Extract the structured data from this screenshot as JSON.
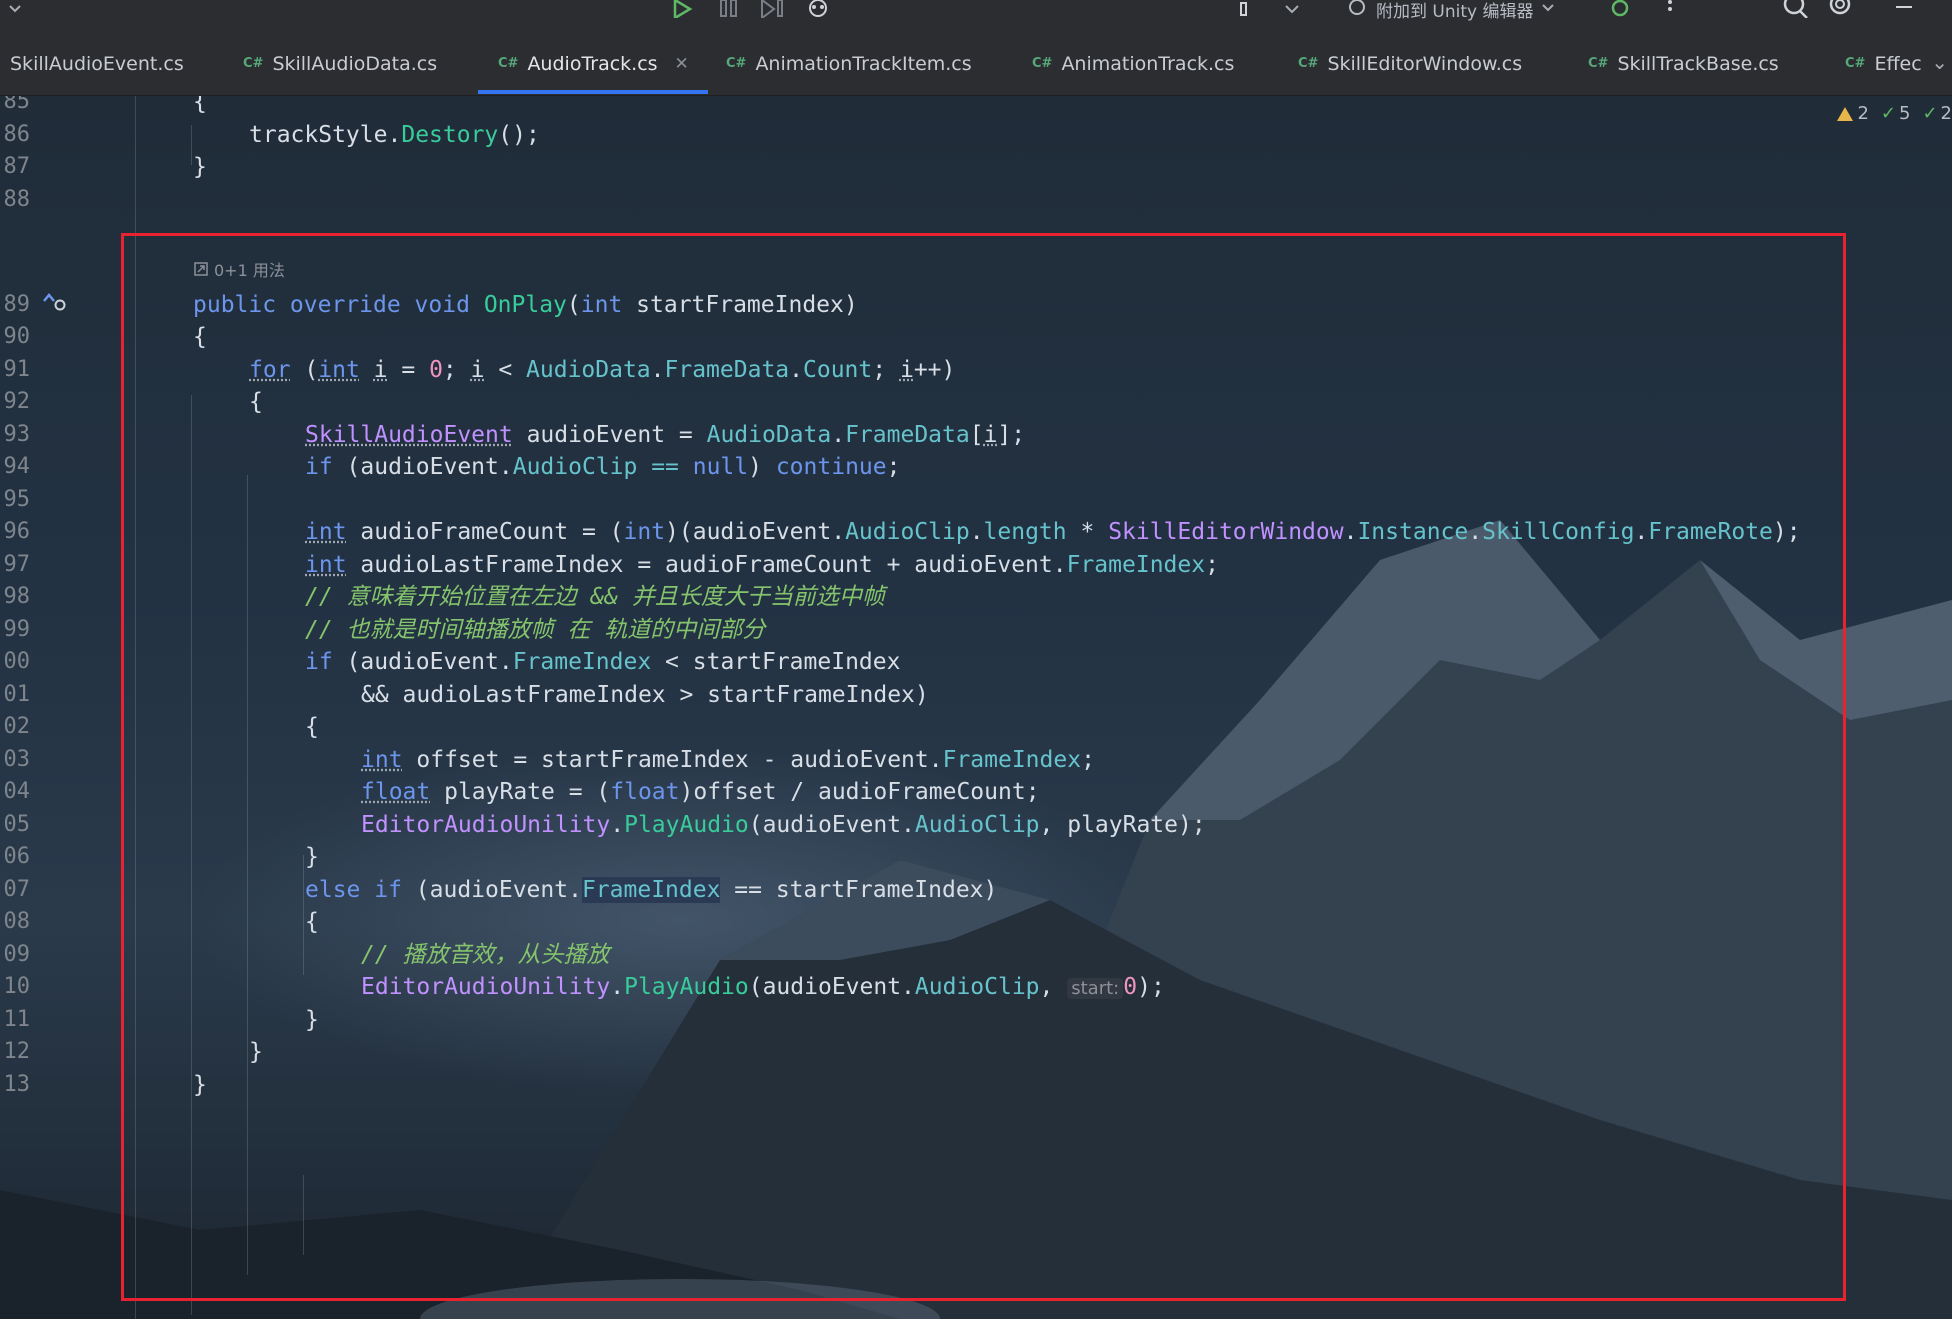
{
  "toolbar": {
    "attach_label": "附加到 Unity 编辑器",
    "run_icon": "run-icon",
    "pause_icon": "pause-icon",
    "step_icon": "step-icon"
  },
  "tabs": [
    {
      "label": "SkillAudioEvent.cs",
      "badge": ""
    },
    {
      "label": "SkillAudioData.cs",
      "badge": "C#"
    },
    {
      "label": "AudioTrack.cs",
      "badge": "C#",
      "active": true
    },
    {
      "label": "AnimationTrackItem.cs",
      "badge": "C#"
    },
    {
      "label": "AnimationTrack.cs",
      "badge": "C#"
    },
    {
      "label": "SkillEditorWindow.cs",
      "badge": "C#"
    },
    {
      "label": "SkillTrackBase.cs",
      "badge": "C#"
    },
    {
      "label": "Effec",
      "badge": "C#"
    }
  ],
  "inspections": {
    "warnings": "2",
    "ok": "5",
    "typos": "2"
  },
  "usage_hint": "0+1 用法",
  "param_hint": "start:",
  "line_numbers": [
    "85",
    "86",
    "87",
    "88",
    "89",
    "90",
    "91",
    "92",
    "93",
    "94",
    "95",
    "96",
    "97",
    "98",
    "99",
    "00",
    "01",
    "02",
    "03",
    "04",
    "05",
    "06",
    "07",
    "08",
    "09",
    "10",
    "11",
    "12",
    "13"
  ],
  "code": {
    "l85": "{",
    "l86_a": "trackStyle",
    "l86_b": ".",
    "l86_c": "Destory",
    "l86_d": "();",
    "l87": "}",
    "l89_kw": "public override void",
    "l89_fn": "OnPlay",
    "l89_p1": "(",
    "l89_ty": "int",
    "l89_rest": " startFrameIndex)",
    "l90": "{",
    "l91_for": "for",
    "l91_a": " (",
    "l91_int": "int",
    "l91_b": " ",
    "l91_i": "i",
    "l91_c": " = ",
    "l91_zero": "0",
    "l91_d": "; ",
    "l91_i2": "i",
    "l91_e": " < ",
    "l91_p1": "AudioData",
    "l91_dot1": ".",
    "l91_p2": "FrameData",
    "l91_dot2": ".",
    "l91_p3": "Count",
    "l91_f": "; ",
    "l91_i3": "i",
    "l91_g": "++)",
    "l92": "{",
    "l93_cls": "SkillAudioEvent",
    "l93_a": " audioEvent = ",
    "l93_p1": "AudioData",
    "l93_dot": ".",
    "l93_p2": "FrameData",
    "l93_b": "[",
    "l93_i": "i",
    "l93_c": "];",
    "l94_if": "if",
    "l94_a": " (audioEvent.",
    "l94_p": "AudioClip",
    "l94_op": " == ",
    "l94_null": "null",
    "l94_b": ") ",
    "l94_cont": "continue",
    "l94_c": ";",
    "l96_int": "int",
    "l96_a": " audioFrameCount = (",
    "l96_int2": "int",
    "l96_b": ")(audioEvent.",
    "l96_p1": "AudioClip",
    "l96_c": ".",
    "l96_p2": "length",
    "l96_d": " * ",
    "l96_cls": "SkillEditorWindow",
    "l96_e": ".",
    "l96_p3": "Instance",
    "l96_f": ".",
    "l96_p4": "SkillConfig",
    "l96_g": ".",
    "l96_p5": "FrameRote",
    "l96_h": ");",
    "l97_int": "int",
    "l97_a": " audioLastFrameIndex = audioFrameCount + audioEvent.",
    "l97_p": "FrameIndex",
    "l97_b": ";",
    "l98": "// 意味着开始位置在左边 && 并且长度大于当前选中帧",
    "l99": "// 也就是时间轴播放帧 在 轨道的中间部分",
    "l100_if": "if",
    "l100_a": " (audioEvent.",
    "l100_p": "FrameIndex",
    "l100_b": " < startFrameIndex",
    "l101": "&& audioLastFrameIndex > startFrameIndex)",
    "l102": "{",
    "l103_int": "int",
    "l103_a": " offset = startFrameIndex - audioEvent.",
    "l103_p": "FrameIndex",
    "l103_b": ";",
    "l104_float": "float",
    "l104_a": " playRate = (",
    "l104_float2": "float",
    "l104_b": ")offset / audioFrameCount;",
    "l105_cls": "EditorAudioUnility",
    "l105_a": ".",
    "l105_fn": "PlayAudio",
    "l105_b": "(audioEvent.",
    "l105_p": "AudioClip",
    "l105_c": ", playRate);",
    "l106": "}",
    "l107_else": "else if",
    "l107_a": " (audioEvent.",
    "l107_p": "FrameIndex",
    "l107_b": " == startFrameIndex)",
    "l108": "{",
    "l109": "// 播放音效，从头播放",
    "l110_cls": "EditorAudioUnility",
    "l110_a": ".",
    "l110_fn": "PlayAudio",
    "l110_b": "(audioEvent.",
    "l110_p": "AudioClip",
    "l110_c": ", ",
    "l110_zero": "0",
    "l110_d": ");",
    "l111": "}",
    "l112": "}",
    "l113": "}"
  }
}
